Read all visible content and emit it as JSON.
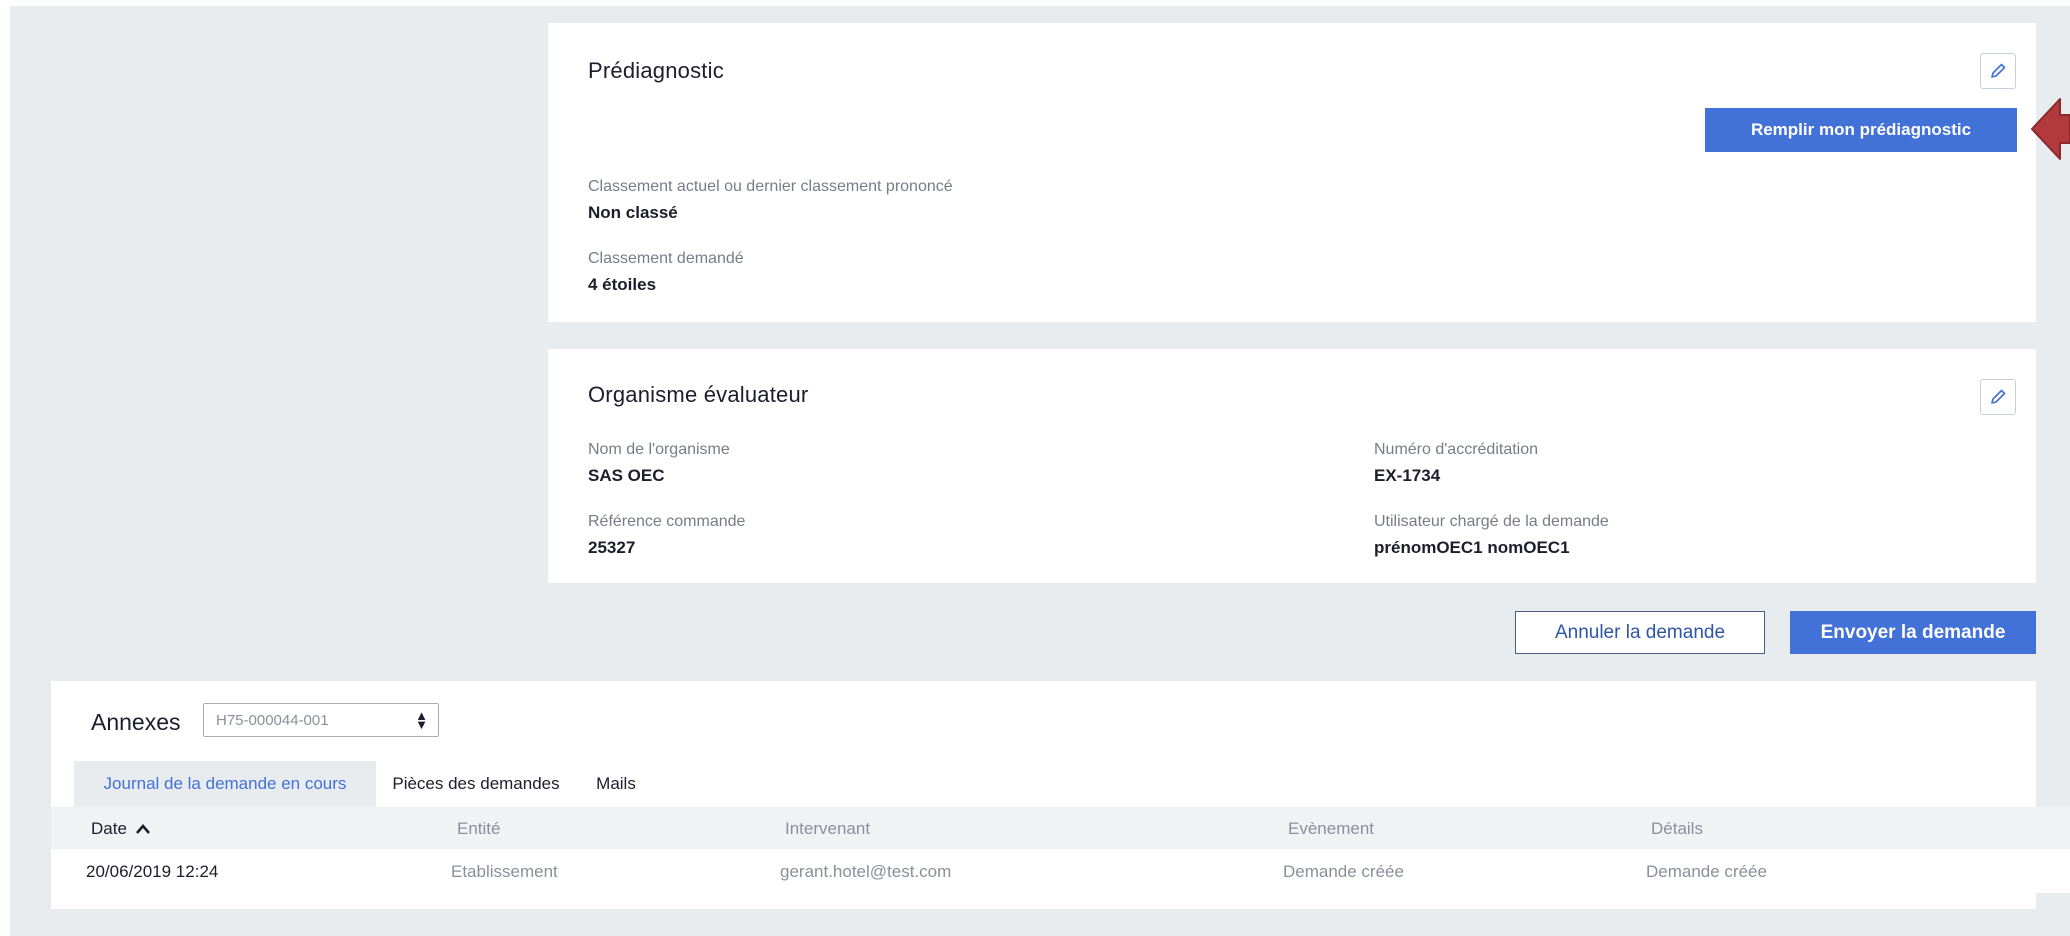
{
  "prediag": {
    "title": "Prédiagnostic",
    "fill_button": "Remplir mon prédiagnostic",
    "current_label": "Classement actuel ou dernier classement prononcé",
    "current_value": "Non classé",
    "requested_label": "Classement demandé",
    "requested_value": "4 étoiles"
  },
  "evaluator": {
    "title": "Organisme évaluateur",
    "org_label": "Nom de l'organisme",
    "org_value": "SAS OEC",
    "accred_label": "Numéro d'accréditation",
    "accred_value": "EX-1734",
    "ref_label": "Référence commande",
    "ref_value": "25327",
    "user_label": "Utilisateur chargé de la demande",
    "user_value": "prénomOEC1 nomOEC1"
  },
  "actions": {
    "cancel": "Annuler la demande",
    "send": "Envoyer la demande"
  },
  "annexes": {
    "title": "Annexes",
    "select_value": "H75-000044-001",
    "tabs": [
      {
        "label": "Journal de la demande en cours"
      },
      {
        "label": "Pièces des demandes"
      },
      {
        "label": "Mails"
      }
    ],
    "columns": [
      "Date",
      "Entité",
      "Intervenant",
      "Evènement",
      "Détails"
    ],
    "rows": [
      [
        "20/06/2019 12:24",
        "Etablissement",
        "gerant.hotel@test.com",
        "Demande créée",
        "Demande créée"
      ]
    ]
  },
  "colors": {
    "accent": "#4271d7",
    "arrow": "#b2393c",
    "background": "#e9ecef"
  }
}
